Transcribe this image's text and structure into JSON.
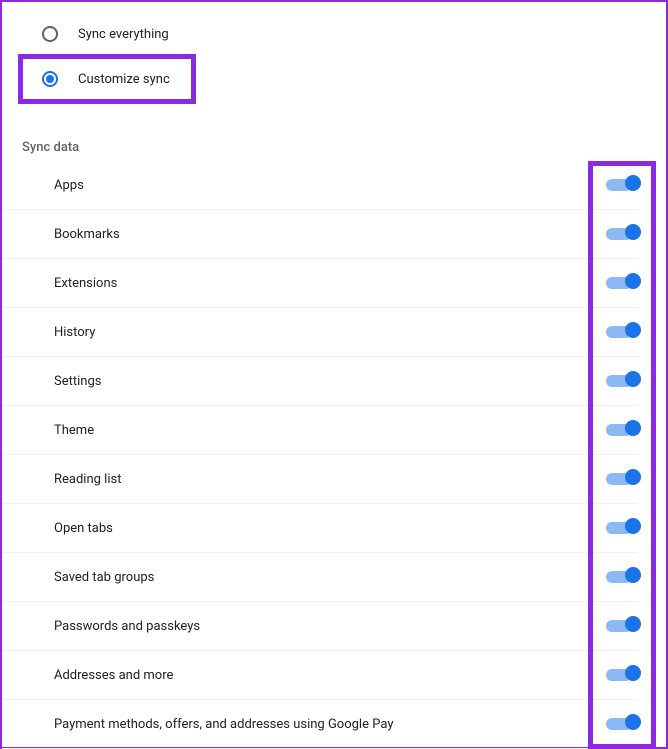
{
  "syncOptions": {
    "syncEverything": {
      "label": "Sync everything",
      "selected": false
    },
    "customizeSync": {
      "label": "Customize sync",
      "selected": true
    }
  },
  "sectionHeader": "Sync data",
  "syncData": [
    {
      "label": "Apps",
      "enabled": true
    },
    {
      "label": "Bookmarks",
      "enabled": true
    },
    {
      "label": "Extensions",
      "enabled": true
    },
    {
      "label": "History",
      "enabled": true
    },
    {
      "label": "Settings",
      "enabled": true
    },
    {
      "label": "Theme",
      "enabled": true
    },
    {
      "label": "Reading list",
      "enabled": true
    },
    {
      "label": "Open tabs",
      "enabled": true
    },
    {
      "label": "Saved tab groups",
      "enabled": true
    },
    {
      "label": "Passwords and passkeys",
      "enabled": true
    },
    {
      "label": "Addresses and more",
      "enabled": true
    },
    {
      "label": "Payment methods, offers, and addresses using Google Pay",
      "enabled": true
    }
  ]
}
